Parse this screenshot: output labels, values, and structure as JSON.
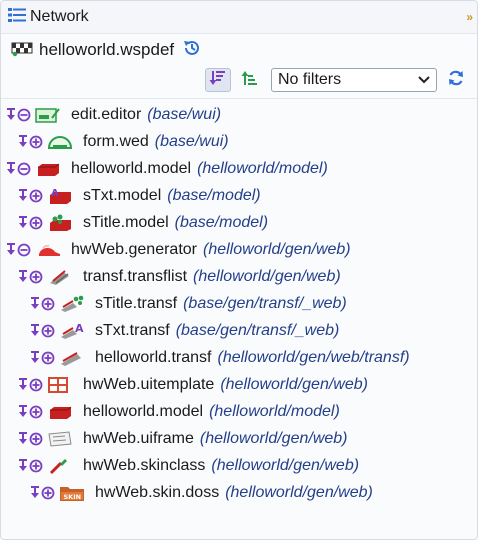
{
  "panel": {
    "title": "Network",
    "file_name": "helloworld.wspdef"
  },
  "toolbar": {
    "filter_value": "No filters"
  },
  "tree": [
    {
      "name": "edit.editor",
      "path": "(base/wui)",
      "depth": 0,
      "icon": "editor-icon"
    },
    {
      "name": "form.wed",
      "path": "(base/wui)",
      "depth": 1,
      "icon": "gauge-form-icon"
    },
    {
      "name": "helloworld.model",
      "path": "(helloworld/model)",
      "depth": 0,
      "icon": "model-brick-icon"
    },
    {
      "name": "sTxt.model",
      "path": "(base/model)",
      "depth": 1,
      "icon": "text-model-icon"
    },
    {
      "name": "sTitle.model",
      "path": "(base/model)",
      "depth": 1,
      "icon": "title-model-icon"
    },
    {
      "name": "hwWeb.generator",
      "path": "(helloworld/gen/web)",
      "depth": 0,
      "icon": "generator-cap-icon"
    },
    {
      "name": "transf.transflist",
      "path": "(helloworld/gen/web)",
      "depth": 1,
      "icon": "transflist-icon"
    },
    {
      "name": "sTitle.transf",
      "path": "(base/gen/transf/_web)",
      "depth": 2,
      "icon": "title-transf-icon"
    },
    {
      "name": "sTxt.transf",
      "path": "(base/gen/transf/_web)",
      "depth": 2,
      "icon": "text-transf-icon"
    },
    {
      "name": "helloworld.transf",
      "path": "(helloworld/gen/web/transf)",
      "depth": 2,
      "icon": "transf-icon"
    },
    {
      "name": "hwWeb.uitemplate",
      "path": "(helloworld/gen/web)",
      "depth": 1,
      "icon": "uitemplate-grid-icon"
    },
    {
      "name": "helloworld.model",
      "path": "(helloworld/model)",
      "depth": 1,
      "icon": "model-brick-icon"
    },
    {
      "name": "hwWeb.uiframe",
      "path": "(helloworld/gen/web)",
      "depth": 1,
      "icon": "uiframe-icon"
    },
    {
      "name": "hwWeb.skinclass",
      "path": "(helloworld/gen/web)",
      "depth": 1,
      "icon": "skinclass-brush-icon"
    },
    {
      "name": "hwWeb.skin.doss",
      "path": "(helloworld/gen/web)",
      "depth": 2,
      "icon": "skin-folder-icon"
    }
  ],
  "icon_labels": {
    "skin": "SKIN"
  },
  "colors": {
    "accent": "#2f6fd6",
    "control": "#7a3fc0",
    "model_red": "#c62020",
    "path_text": "#233f8a"
  }
}
